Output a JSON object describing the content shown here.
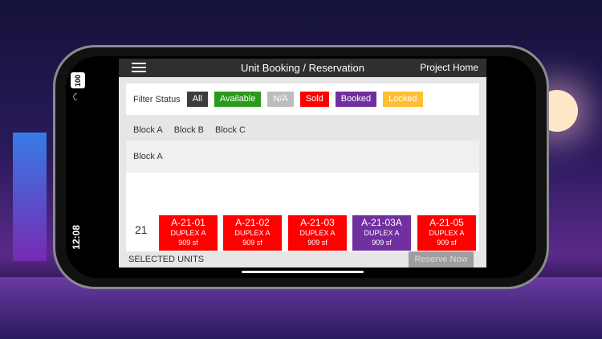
{
  "status_bar": {
    "battery": "100",
    "time": "12:08"
  },
  "header": {
    "title": "Unit Booking / Reservation",
    "project_home": "Project Home"
  },
  "filter": {
    "label": "Filter Status",
    "buttons": [
      {
        "label": "All",
        "color": "#3c3c3c"
      },
      {
        "label": "Available",
        "color": "#2a9a1a"
      },
      {
        "label": "N/A",
        "color": "#bdbdbd"
      },
      {
        "label": "Sold",
        "color": "#ff0000"
      },
      {
        "label": "Booked",
        "color": "#7030a0"
      },
      {
        "label": "Locked",
        "color": "#ffbf33"
      }
    ]
  },
  "blocks": {
    "tabs": [
      "Block A",
      "Block B",
      "Block C"
    ],
    "selected_heading": "Block A"
  },
  "units": {
    "row_label": "21",
    "cards": [
      {
        "code": "A-21-01",
        "type": "DUPLEX A",
        "size": "909 sf",
        "color": "#ff0000"
      },
      {
        "code": "A-21-02",
        "type": "DUPLEX A",
        "size": "909 sf",
        "color": "#ff0000"
      },
      {
        "code": "A-21-03",
        "type": "DUPLEX A",
        "size": "909 sf",
        "color": "#ff0000"
      },
      {
        "code": "A-21-03A",
        "type": "DUPLEX A",
        "size": "909 sf",
        "color": "#7030a0"
      },
      {
        "code": "A-21-05",
        "type": "DUPLEX A",
        "size": "909 sf",
        "color": "#ff0000"
      }
    ]
  },
  "footer": {
    "selected_label": "SELECTED UNITS",
    "reserve_label": "Reserve Now"
  }
}
